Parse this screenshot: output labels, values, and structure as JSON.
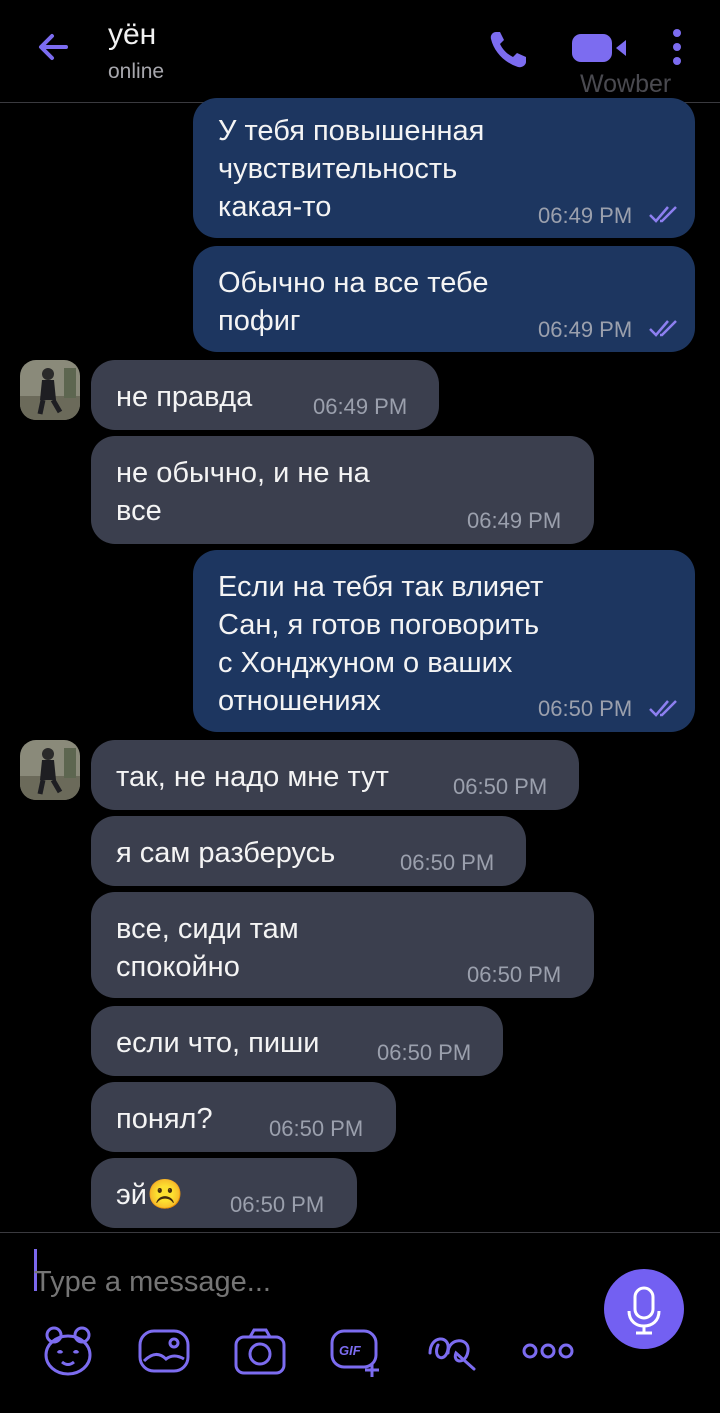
{
  "header": {
    "contact_name": "уён",
    "status": "online",
    "watermark": "Wowber"
  },
  "messages": [
    {
      "text": "У тебя повышенная\nчувствительность\nкакая-то",
      "time": "06:49 PM",
      "dir": "out"
    },
    {
      "text": "Обычно на все тебе\nпофиг",
      "time": "06:49 PM",
      "dir": "out"
    },
    {
      "text": "не правда",
      "time": "06:49 PM",
      "dir": "in"
    },
    {
      "text": "не обычно, и не на\nвсе",
      "time": "06:49 PM",
      "dir": "in"
    },
    {
      "text": "Если на тебя так влияет\nСан, я готов поговорить\nс Хонджуном о ваших\nотношениях",
      "time": "06:50 PM",
      "dir": "out"
    },
    {
      "text": "так, не надо мне тут",
      "time": "06:50 PM",
      "dir": "in"
    },
    {
      "text": "я сам разберусь",
      "time": "06:50 PM",
      "dir": "in"
    },
    {
      "text": "все, сиди там\nспокойно",
      "time": "06:50 PM",
      "dir": "in"
    },
    {
      "text": "если что, пиши",
      "time": "06:50 PM",
      "dir": "in"
    },
    {
      "text": "понял?",
      "time": "06:50 PM",
      "dir": "in"
    },
    {
      "text": "эй☹️",
      "time": "06:50 PM",
      "dir": "in"
    }
  ],
  "composer": {
    "placeholder": "Type a message..."
  },
  "icons": {
    "back": "arrow-left-icon",
    "call": "phone-icon",
    "video": "video-camera-icon",
    "more": "more-vertical-icon",
    "mic": "microphone-icon",
    "toolbar": [
      "sticker-icon",
      "gallery-icon",
      "camera-icon",
      "gif-icon",
      "doodle-icon",
      "more-horizontal-icon"
    ]
  },
  "colors": {
    "accent": "#7360f2",
    "outgoing_bubble": "#1d3660",
    "incoming_bubble": "#3b3f4e",
    "background": "#000000"
  }
}
